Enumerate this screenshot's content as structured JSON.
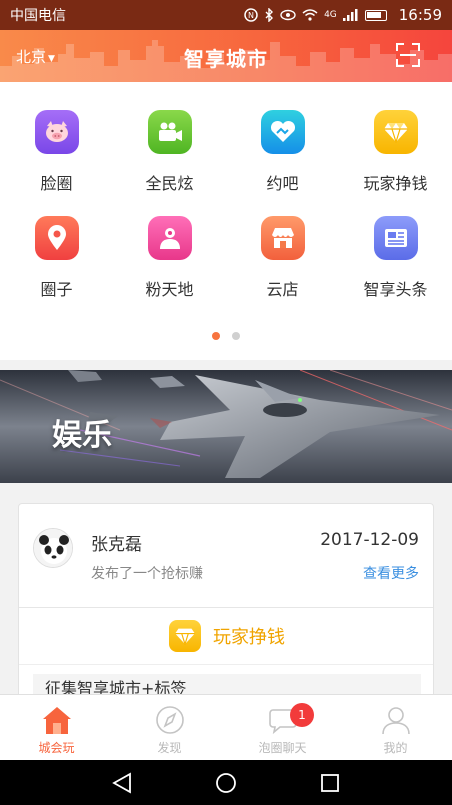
{
  "status_bar": {
    "carrier": "中国电信",
    "network": "4G",
    "time": "16:59"
  },
  "header": {
    "city": "北京",
    "title": "智享城市"
  },
  "grid_items": [
    {
      "label": "脸圈",
      "icon": "pig-face-icon",
      "color": "#8b5cf6"
    },
    {
      "label": "全民炫",
      "icon": "video-camera-icon",
      "color": "#6dc82d"
    },
    {
      "label": "约吧",
      "icon": "handshake-heart-icon",
      "color": "#1aa6e8"
    },
    {
      "label": "玩家挣钱",
      "icon": "diamond-icon",
      "color": "#f8b500"
    },
    {
      "label": "圈子",
      "icon": "location-pin-icon",
      "color": "#f5564a"
    },
    {
      "label": "粉天地",
      "icon": "users-icon",
      "color": "#f04fa0"
    },
    {
      "label": "云店",
      "icon": "store-icon",
      "color": "#f57a4a"
    },
    {
      "label": "智享头条",
      "icon": "newspaper-icon",
      "color": "#6b7cf0"
    }
  ],
  "pager": {
    "pages": 2,
    "active": 1
  },
  "banner": {
    "label": "娱乐"
  },
  "post": {
    "username": "张克磊",
    "date": "2017-12-09",
    "action": "发布了一个抢标赚",
    "more_link": "查看更多",
    "category": "玩家挣钱",
    "task": "征集智享城市+标签"
  },
  "tabs": [
    {
      "label": "城会玩",
      "icon": "house-icon",
      "active": true
    },
    {
      "label": "发现",
      "icon": "compass-icon",
      "active": false
    },
    {
      "label": "泡圈聊天",
      "icon": "chat-bubble-icon",
      "active": false,
      "badge": "1"
    },
    {
      "label": "我的",
      "icon": "person-icon",
      "active": false
    }
  ],
  "colors": {
    "accent": "#f7643d",
    "link": "#3b8fe0",
    "gold": "#f0a400"
  }
}
